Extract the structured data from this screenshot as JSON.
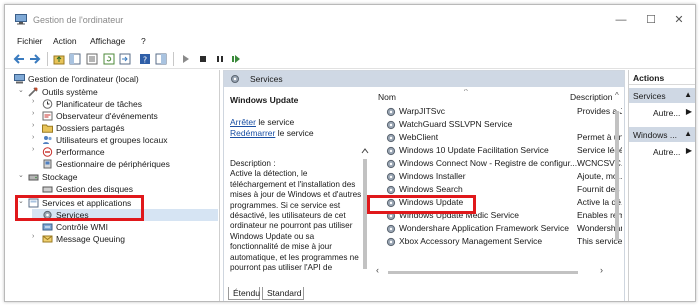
{
  "window": {
    "title": "Gestion de l'ordinateur",
    "minimize": "—",
    "maximize": "☐",
    "close": "✕"
  },
  "menu": [
    "Fichier",
    "Action",
    "Affichage",
    "?"
  ],
  "tree": {
    "root": "Gestion de l'ordinateur (local)",
    "items": [
      {
        "label": "Outils système",
        "arrow": "⌄"
      },
      {
        "label": "Planificateur de tâches",
        "arrow": "›"
      },
      {
        "label": "Observateur d'événements",
        "arrow": "›"
      },
      {
        "label": "Dossiers partagés",
        "arrow": "›"
      },
      {
        "label": "Utilisateurs et groupes locaux",
        "arrow": "›"
      },
      {
        "label": "Performance",
        "arrow": "›"
      },
      {
        "label": "Gestionnaire de périphériques",
        "arrow": ""
      },
      {
        "label": "Stockage",
        "arrow": "⌄"
      },
      {
        "label": "Gestion des disques",
        "arrow": ""
      },
      {
        "label": "Services et applications",
        "arrow": "⌄"
      },
      {
        "label": "Services",
        "arrow": ""
      },
      {
        "label": "Contrôle WMI",
        "arrow": ""
      },
      {
        "label": "Message Queuing",
        "arrow": "›"
      }
    ]
  },
  "center": {
    "header": "Services",
    "selected_title": "Windows Update",
    "stop_link": "Arrêter",
    "stop_suffix": " le service",
    "restart_link": "Redémarrer",
    "restart_suffix": " le service",
    "description": "Description :\nActive la détection, le téléchargement et l'installation des mises à jour de Windows et d'autres programmes. Si ce service est désactivé, les utilisateurs de cet ordinateur ne pourront pas utiliser Windows Update ou sa fonctionnalité de mise à jour automatique, et les programmes ne pourront pas utiliser l'API de",
    "columns": {
      "name": "Nom",
      "description": "Description"
    },
    "rows": [
      {
        "name": "WarpJITSvc",
        "description": "Provides a JI"
      },
      {
        "name": "WatchGuard SSLVPN Service",
        "description": ""
      },
      {
        "name": "WebClient",
        "description": "Permet à un"
      },
      {
        "name": "Windows 10 Update Facilitation Service",
        "description": "Service légé"
      },
      {
        "name": "Windows Connect Now - Registre de configur...",
        "description": "WCNCSVC..."
      },
      {
        "name": "Windows Installer",
        "description": "Ajoute, mo..."
      },
      {
        "name": "Windows Search",
        "description": "Fournit des ..."
      },
      {
        "name": "Windows Update",
        "description": "Active la dé."
      },
      {
        "name": "Windows Update Medic Service",
        "description": "Enables rem"
      },
      {
        "name": "Wondershare Application Framework Service",
        "description": "Wondershar"
      },
      {
        "name": "Xbox Accessory Management Service",
        "description": "This service"
      }
    ],
    "tabs": [
      "Étendu",
      "Standard"
    ]
  },
  "actions": {
    "header": "Actions",
    "groups": [
      {
        "label": "Services",
        "more": "Autre..."
      },
      {
        "label": "Windows ...",
        "more": "Autre..."
      }
    ]
  },
  "colors": {
    "highlight": "#e0181b",
    "pane_header": "#cfd8e4",
    "link": "#1a4fa3"
  }
}
